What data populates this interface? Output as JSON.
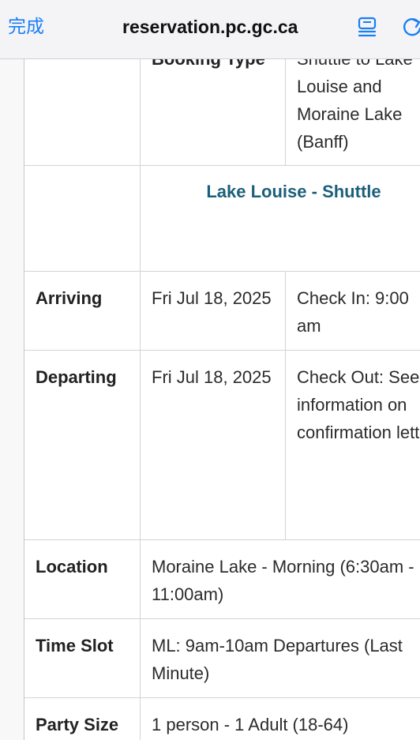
{
  "browser": {
    "done_label": "完成",
    "url": "reservation.pc.gc.ca"
  },
  "booking": {
    "type_label": "Booking Type",
    "type_value": "Shuttle to Lake Louise and Moraine Lake (Banff)",
    "shuttle_name": "Lake Louise - Shuttle",
    "arriving_label": "Arriving",
    "arriving_date": "Fri Jul 18, 2025",
    "check_in": "Check In: 9:00 am",
    "departing_label": "Departing",
    "departing_date": "Fri Jul 18, 2025",
    "check_out": "Check Out: See information on confirmation letter",
    "location_label": "Location",
    "location_value": "Moraine Lake - Morning (6:30am - 11:00am)",
    "time_slot_label": "Time Slot",
    "time_slot_value": "ML: 9am-10am Departures (Last Minute)",
    "party_size_label": "Party Size",
    "party_size_value": "1 person - 1 Adult (18-64)"
  },
  "colors": {
    "link": "#1a7ef5",
    "shuttle_title": "#1b5f7a"
  }
}
